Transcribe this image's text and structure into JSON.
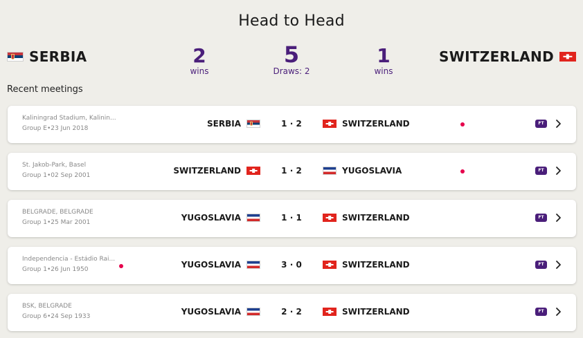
{
  "header": {
    "title": "Head to Head",
    "home_team": "SERBIA",
    "away_team": "SWITZERLAND",
    "home_wins": "2",
    "home_wins_label": "wins",
    "total": "5",
    "draws_label": "Draws: 2",
    "away_wins": "1",
    "away_wins_label": "wins"
  },
  "recent_label": "Recent meetings",
  "colors": {
    "accent": "#4a1e7a",
    "live_dot": "#e6004c",
    "background": "#efeee9"
  },
  "matches": [
    {
      "venue": "Kaliningrad Stadium, Kalinin...",
      "group": "Group E•23 Jun 2018",
      "home": "SERBIA",
      "home_flag": "serbia",
      "score_home": "1",
      "score_away": "2",
      "away": "SWITZERLAND",
      "away_flag": "swiss",
      "status": "FT"
    },
    {
      "venue": "St. Jakob-Park, Basel",
      "group": "Group 1•02 Sep 2001",
      "home": "SWITZERLAND",
      "home_flag": "swiss",
      "score_home": "1",
      "score_away": "2",
      "away": "YUGOSLAVIA",
      "away_flag": "yugo",
      "status": "FT"
    },
    {
      "venue": "BELGRADE, BELGRADE",
      "group": "Group 1•25 Mar 2001",
      "home": "YUGOSLAVIA",
      "home_flag": "yugo",
      "score_home": "1",
      "score_away": "1",
      "away": "SWITZERLAND",
      "away_flag": "swiss",
      "status": "FT"
    },
    {
      "venue": "Independencia - Estádio Rai...",
      "group": "Group 1•26 Jun 1950",
      "home": "YUGOSLAVIA",
      "home_flag": "yugo",
      "score_home": "3",
      "score_away": "0",
      "away": "SWITZERLAND",
      "away_flag": "swiss",
      "status": "FT"
    },
    {
      "venue": "BSK, BELGRADE",
      "group": "Group 6•24 Sep 1933",
      "home": "YUGOSLAVIA",
      "home_flag": "yugo",
      "score_home": "2",
      "score_away": "2",
      "away": "SWITZERLAND",
      "away_flag": "swiss",
      "status": "FT"
    }
  ]
}
